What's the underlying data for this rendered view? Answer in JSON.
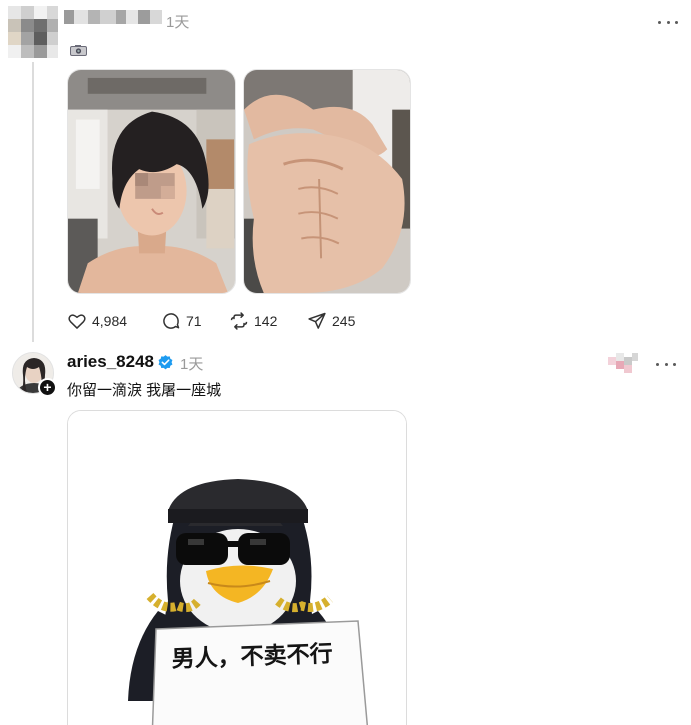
{
  "post1": {
    "time": "1天",
    "icons": {
      "avatar": "avatar-blurred-icon",
      "attachment": "camera-icon",
      "menu": "more-icon"
    },
    "stats": {
      "likes": "4,984",
      "replies": "71",
      "reposts": "142",
      "shares": "245"
    }
  },
  "post2": {
    "username": "aries_8248",
    "time": "1天",
    "caption": "你留一滴淚 我屠一座城",
    "meme_text": "男人，不卖不行",
    "icons": {
      "verified": "verified-badge-icon",
      "follow": "plus-icon",
      "menu": "more-icon"
    }
  },
  "colors": {
    "verified": "#1d9bf0",
    "text": "#101010",
    "muted": "#9a9a9a",
    "divider": "#dcdcdc"
  }
}
